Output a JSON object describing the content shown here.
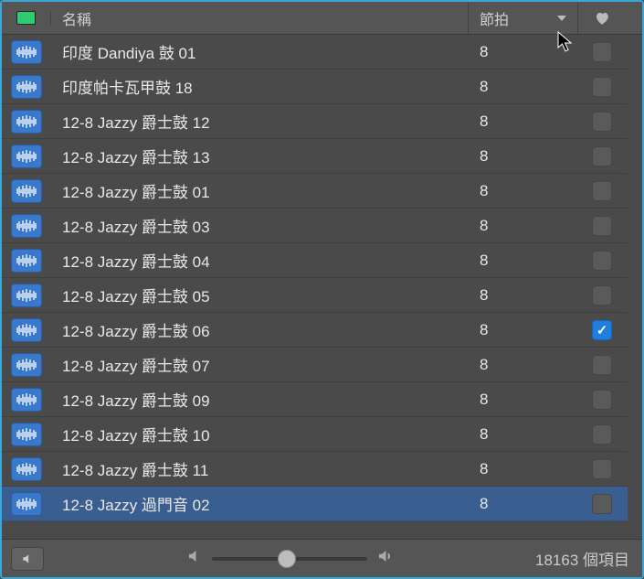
{
  "header": {
    "name_label": "名稱",
    "beats_label": "節拍"
  },
  "rows": [
    {
      "name": "印度 Dandiya 鼓 01",
      "beats": "8",
      "fav": false,
      "selected": false
    },
    {
      "name": "印度帕卡瓦甲鼓 18",
      "beats": "8",
      "fav": false,
      "selected": false
    },
    {
      "name": "12-8 Jazzy 爵士鼓 12",
      "beats": "8",
      "fav": false,
      "selected": false
    },
    {
      "name": "12-8 Jazzy 爵士鼓 13",
      "beats": "8",
      "fav": false,
      "selected": false
    },
    {
      "name": "12-8 Jazzy 爵士鼓 01",
      "beats": "8",
      "fav": false,
      "selected": false
    },
    {
      "name": "12-8 Jazzy 爵士鼓 03",
      "beats": "8",
      "fav": false,
      "selected": false
    },
    {
      "name": "12-8 Jazzy 爵士鼓 04",
      "beats": "8",
      "fav": false,
      "selected": false
    },
    {
      "name": "12-8 Jazzy 爵士鼓 05",
      "beats": "8",
      "fav": false,
      "selected": false
    },
    {
      "name": "12-8 Jazzy 爵士鼓 06",
      "beats": "8",
      "fav": true,
      "selected": false
    },
    {
      "name": "12-8 Jazzy 爵士鼓 07",
      "beats": "8",
      "fav": false,
      "selected": false
    },
    {
      "name": "12-8 Jazzy 爵士鼓 09",
      "beats": "8",
      "fav": false,
      "selected": false
    },
    {
      "name": "12-8 Jazzy 爵士鼓 10",
      "beats": "8",
      "fav": false,
      "selected": false
    },
    {
      "name": "12-8 Jazzy 爵士鼓 11",
      "beats": "8",
      "fav": false,
      "selected": false
    },
    {
      "name": "12-8 Jazzy 過門音 02",
      "beats": "8",
      "fav": false,
      "selected": true
    }
  ],
  "footer": {
    "item_count": "18163 個項目"
  }
}
